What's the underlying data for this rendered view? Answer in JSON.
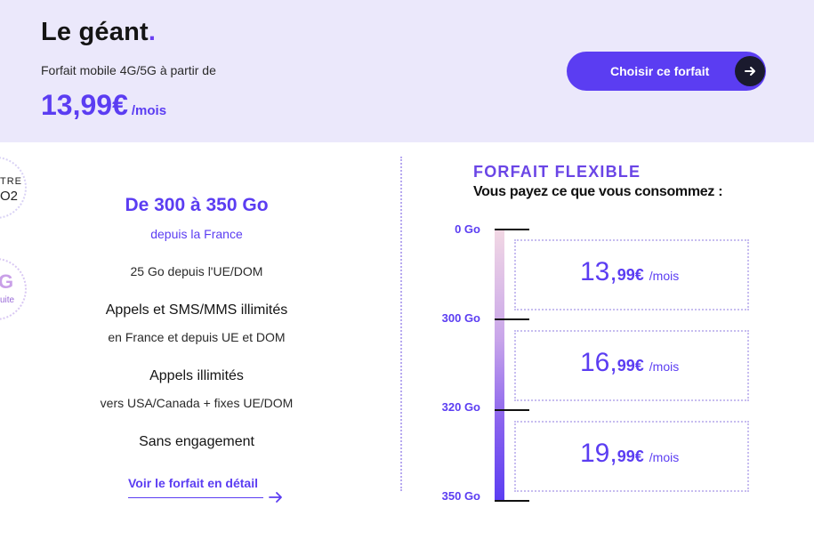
{
  "header": {
    "plan_name": "Le géant",
    "plan_name_dot": ".",
    "subtitle": "Forfait mobile 4G/5G à partir de",
    "price": "13,99€",
    "price_period": "/mois",
    "cta_label": "Choisir ce forfait"
  },
  "badges": {
    "badge1_line1": "TRE",
    "badge1_line2": "O2",
    "badge2_line1": "G",
    "badge2_line2": "uite"
  },
  "features": {
    "data_title": "De 300 à 350 Go",
    "data_sub": "depuis la France",
    "eu_data": "25 Go depuis l'UE/DOM",
    "calls_title": "Appels et SMS/MMS illimités",
    "calls_sub": "en France et depuis UE et DOM",
    "intl_title": "Appels illimités",
    "intl_sub": "vers USA/Canada + fixes UE/DOM",
    "commitment": "Sans engagement",
    "detail_link": "Voir le forfait en détail"
  },
  "flexible": {
    "title": "FORFAIT FLEXIBLE",
    "subtitle": "Vous payez ce que vous consommez :",
    "ticks": [
      "0 Go",
      "300 Go",
      "320 Go",
      "350 Go"
    ],
    "tiers": [
      {
        "whole": "13,",
        "cents": "99€",
        "period": "/mois"
      },
      {
        "whole": "16,",
        "cents": "99€",
        "period": "/mois"
      },
      {
        "whole": "19,",
        "cents": "99€",
        "period": "/mois"
      }
    ]
  },
  "colors": {
    "accent": "#5b3df2",
    "header_bg": "#ebe8fb",
    "cta_arrow_bg": "#1a1a2e"
  },
  "icons": [
    "arrow-right-icon",
    "arrow-right-link-icon"
  ]
}
